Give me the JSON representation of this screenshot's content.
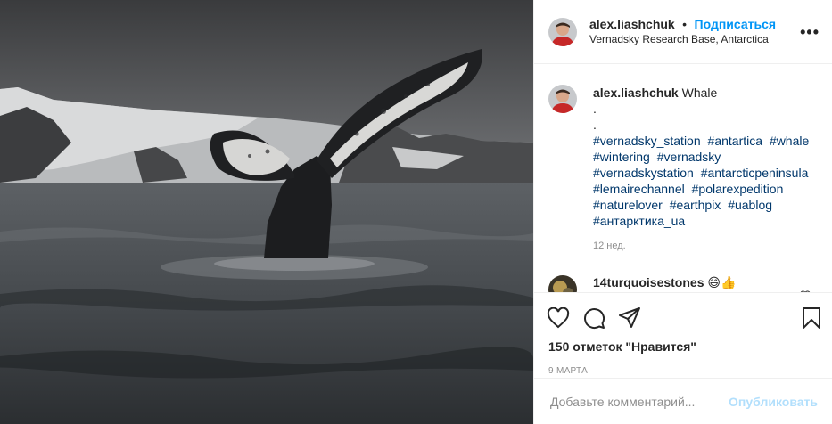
{
  "post": {
    "image_alt": "Whale",
    "author": {
      "username": "alex.liashchuk",
      "follow_label": "Подписаться",
      "separator": "•",
      "location": "Vernadsky Research Base, Antarctica"
    },
    "more_label": "•••",
    "caption": {
      "username": "alex.liashchuk",
      "text": "Whale",
      "dot1": ".",
      "dot2": ".",
      "hashtags": [
        "#vernadsky_station",
        "#antartica",
        "#whale",
        "#wintering",
        "#vernadsky",
        "#vernadskystation",
        "#antarcticpeninsula",
        "#lemairechannel",
        "#polarexpedition",
        "#naturelover",
        "#earthpix",
        "#uablog",
        "#антарктика_ua"
      ],
      "time": "12 нед."
    },
    "comment": {
      "username": "14turquoisestones",
      "emoji": "😄👍"
    },
    "likes": "150 отметок \"Нравится\"",
    "date": "9 МАРТА",
    "add_comment": {
      "placeholder": "Добавьте комментарий...",
      "publish_label": "Опубликовать"
    },
    "icons": {
      "like": "heart-icon",
      "comment": "comment-icon",
      "share": "share-icon",
      "save": "bookmark-icon",
      "comment_like": "heart-icon"
    },
    "colors": {
      "link": "#0095f6",
      "hashtag": "#00376b",
      "muted": "#8e8e8e",
      "publish_disabled": "#b2dffc"
    }
  }
}
